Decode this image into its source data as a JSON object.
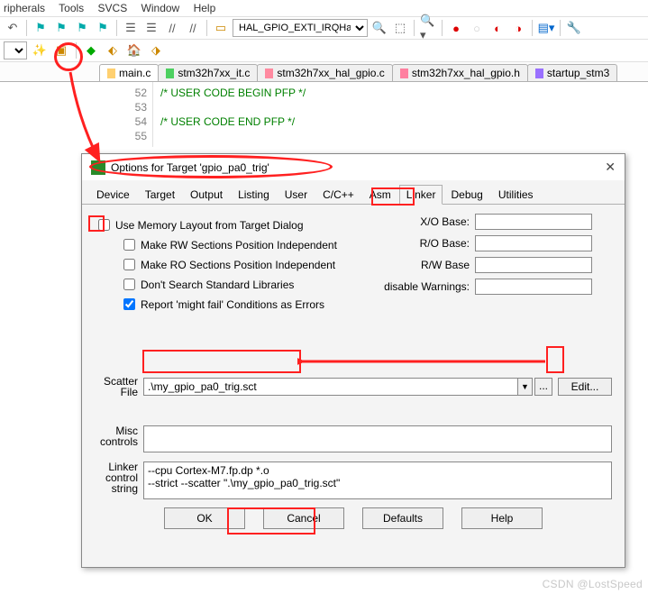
{
  "menu": {
    "peripherals": "ripherals",
    "tools": "Tools",
    "svcs": "SVCS",
    "window": "Window",
    "help": "Help"
  },
  "tb_combo1": "HAL_GPIO_EXTI_IRQHand",
  "file_tabs": [
    {
      "label": "main.c",
      "color": "#ffd070",
      "active": true
    },
    {
      "label": "stm32h7xx_it.c",
      "color": "#4dd060",
      "active": false
    },
    {
      "label": "stm32h7xx_hal_gpio.c",
      "color": "#ff8aa0",
      "active": false
    },
    {
      "label": "stm32h7xx_hal_gpio.h",
      "color": "#ff80a0",
      "active": false
    },
    {
      "label": "startup_stm3",
      "color": "#9a70ff",
      "active": false
    }
  ],
  "code": {
    "lines": [
      "52",
      "53",
      "54",
      "55"
    ],
    "l52": "/* USER CODE BEGIN PFP */",
    "l53": "",
    "l54": "/* USER CODE END PFP */",
    "l55": ""
  },
  "dialog": {
    "title": "Options for Target 'gpio_pa0_trig'",
    "tabs": [
      "Device",
      "Target",
      "Output",
      "Listing",
      "User",
      "C/C++",
      "Asm",
      "Linker",
      "Debug",
      "Utilities"
    ],
    "active_tab": "Linker",
    "checks": {
      "mem_layout": {
        "label": "Use Memory Layout from Target Dialog",
        "checked": false
      },
      "rw_pi": {
        "label": "Make RW Sections Position Independent",
        "checked": false
      },
      "ro_pi": {
        "label": "Make RO Sections Position Independent",
        "checked": false
      },
      "no_stdlib": {
        "label": "Don't Search Standard Libraries",
        "checked": false
      },
      "might_fail": {
        "label": "Report 'might fail' Conditions as Errors",
        "checked": true
      }
    },
    "fields": {
      "xo": "X/O Base:",
      "ro": "R/O Base:",
      "rw": "R/W Base",
      "dw": "disable Warnings:"
    },
    "scatter": {
      "label": "Scatter\nFile",
      "value": ".\\my_gpio_pa0_trig.sct",
      "browse": "...",
      "edit": "Edit..."
    },
    "misc": {
      "label": "Misc\ncontrols",
      "value": ""
    },
    "linker_ctrl": {
      "label": "Linker\ncontrol\nstring",
      "value": "--cpu Cortex-M7.fp.dp *.o\n--strict --scatter \".\\my_gpio_pa0_trig.sct\""
    },
    "buttons": {
      "ok": "OK",
      "cancel": "Cancel",
      "defaults": "Defaults",
      "help": "Help"
    }
  },
  "watermark": "CSDN @LostSpeed"
}
